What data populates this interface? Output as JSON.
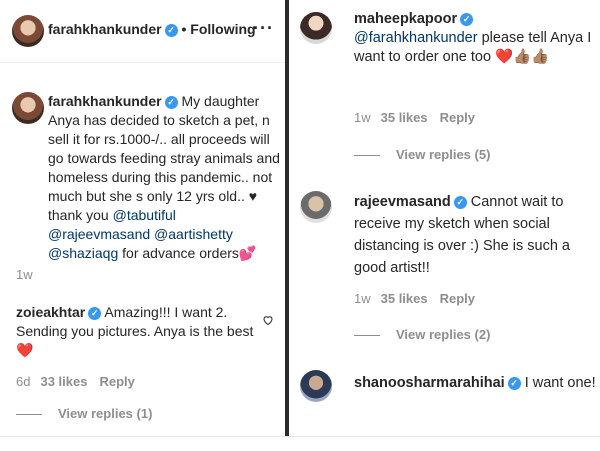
{
  "left": {
    "header": {
      "username": "farahkhankunder",
      "follow_status": "• Following",
      "more": "···"
    },
    "caption": {
      "username": "farahkhankunder",
      "text_1": "My daughter Anya has decided to sketch a pet, n sell it for rs.1000-/.. all proceeds will go towards feeding stray animals and homeless during this pandemic.. not much but she s only 12 yrs old.. ",
      "heart": "♥",
      "thanks": " thank you ",
      "mention_1": "@tabutiful",
      "mention_2": "@rajeevmasand",
      "mention_3": "@aartishetty",
      "mention_4": "@shaziaqg",
      "text_2": " for advance orders",
      "emoji": "💕",
      "time": "1w"
    },
    "comment": {
      "username": "zoieakhtar",
      "text": "Amazing!!! I want 2. Sending you pictures. Anya is the best",
      "emoji": "❤️",
      "time": "6d",
      "likes": "33 likes",
      "reply": "Reply",
      "view_replies": "View replies (1)"
    }
  },
  "right": {
    "comments": [
      {
        "username": "maheepkapoor",
        "mention": "@farahkhankunder",
        "text": " please tell Anya I want to order one too ",
        "emoji": "❤️👍🏽👍🏽",
        "time": "1w",
        "likes": "35 likes",
        "reply": "Reply",
        "view_replies": "View replies (5)"
      },
      {
        "username": "rajeevmasand",
        "text": "Cannot wait to receive my sketch when social distancing is over :) She is such a good artist!!",
        "time": "1w",
        "likes": "35 likes",
        "reply": "Reply",
        "view_replies": "View replies (2)"
      },
      {
        "username": "shanoosharmarahihai",
        "text": "I want one!"
      }
    ]
  },
  "colors": {
    "text": "#262626",
    "muted": "#8e8e8e",
    "link": "#00376b",
    "verified": "#3897f0",
    "heart": "#ed4956"
  }
}
